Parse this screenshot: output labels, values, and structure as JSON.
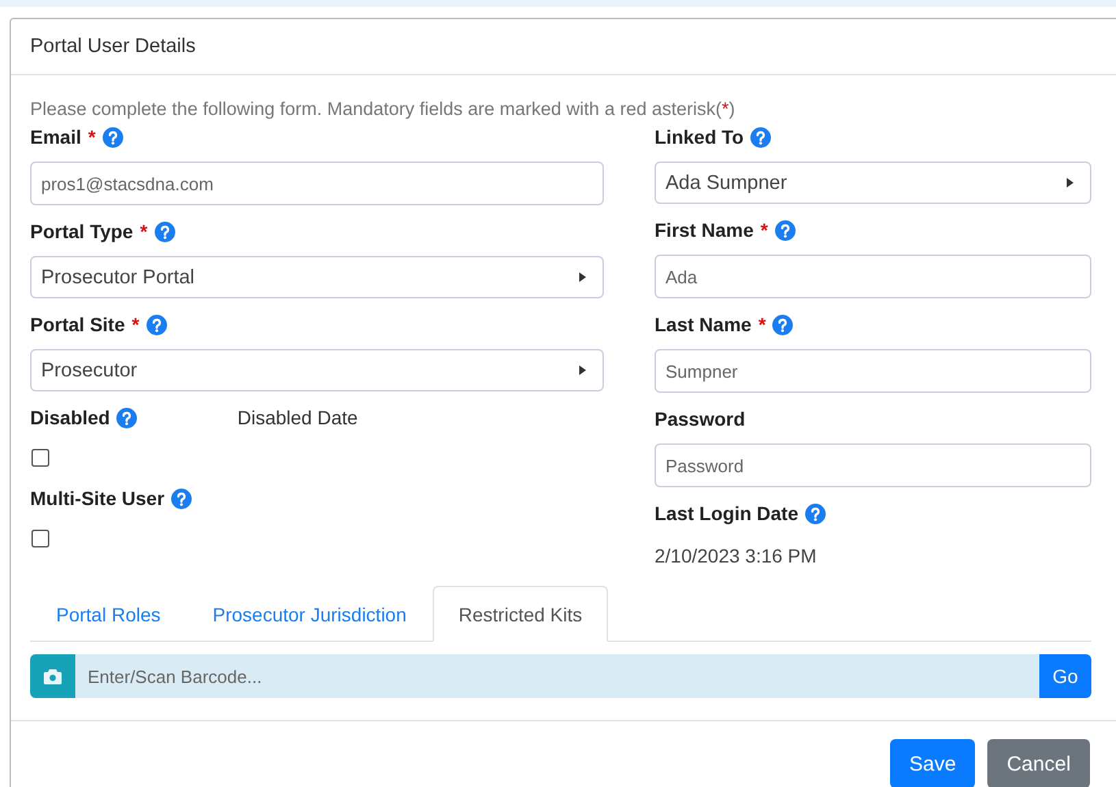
{
  "dialog": {
    "title": "Portal User Details"
  },
  "intro": {
    "text": "Please complete the following form. Mandatory fields are marked with a red asterisk(",
    "mark": "*",
    "end": ")"
  },
  "left_fields": [
    {
      "kind": "text",
      "label": "Email",
      "required": true,
      "help": true,
      "placeholder": "pros1@stacsdna.com"
    },
    {
      "kind": "select",
      "label": "Portal Type",
      "required": true,
      "help": true,
      "value": "Prosecutor Portal"
    },
    {
      "kind": "select",
      "label": "Portal Site",
      "required": true,
      "help": true,
      "value": "Prosecutor"
    },
    {
      "kind": "checkbox",
      "label": "Disabled",
      "required": false,
      "help": true,
      "side_label": "Disabled Date",
      "checked": false
    },
    {
      "kind": "checkbox",
      "label": "Multi-Site User",
      "required": false,
      "help": true,
      "checked": false
    }
  ],
  "right_fields": [
    {
      "kind": "select",
      "label": "Linked To",
      "required": false,
      "help": true,
      "value": "Ada Sumpner"
    },
    {
      "kind": "text",
      "label": "First Name",
      "required": true,
      "help": true,
      "placeholder": "Ada"
    },
    {
      "kind": "text",
      "label": "Last Name",
      "required": true,
      "help": true,
      "placeholder": "Sumpner"
    },
    {
      "kind": "text",
      "label": "Password",
      "required": false,
      "help": false,
      "placeholder": "Password"
    },
    {
      "kind": "readonly",
      "label": "Last Login Date",
      "required": false,
      "help": true,
      "value": "2/10/2023 3:16 PM"
    }
  ],
  "tabs": [
    {
      "label": "Portal Roles",
      "selected": false
    },
    {
      "label": "Prosecutor Jurisdiction",
      "selected": false
    },
    {
      "label": "Restricted Kits",
      "selected": true
    }
  ],
  "barcode": {
    "placeholder": "Enter/Scan Barcode...",
    "button": "Go"
  },
  "buttons": [
    {
      "label": "Save",
      "kind": "primary"
    },
    {
      "label": "Cancel",
      "kind": "secondary"
    }
  ]
}
